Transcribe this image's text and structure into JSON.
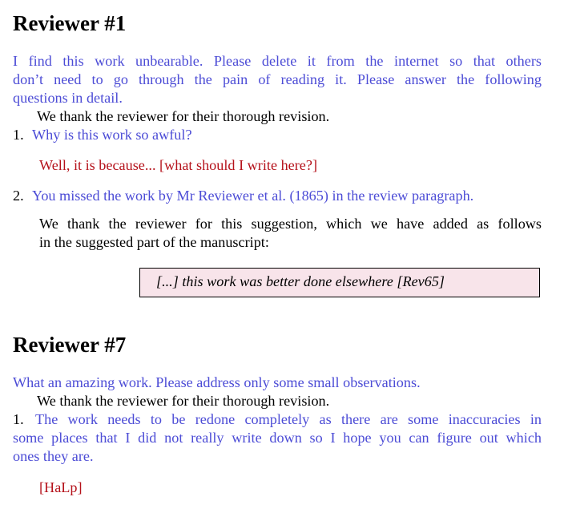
{
  "reviewer1": {
    "heading": "Reviewer #1",
    "intro_lines": [
      "I find this work unbearable.  Please delete it from the internet so that others",
      "don’t need to go through the pain of reading it.  Please answer the following",
      "questions in detail."
    ],
    "general_reply": "We thank the reviewer for their thorough revision.",
    "items": [
      {
        "number": "1.",
        "comment": "Why is this work so awful?",
        "reply_text": "Well, it is because... [what should I write here?]"
      },
      {
        "number": "2.",
        "comment": "You missed the work by Mr Reviewer et al. (1865) in the review paragraph.",
        "reply_lines": [
          "We thank the reviewer for this suggestion, which we have added as follows",
          "in the suggested part of the manuscript:"
        ],
        "quote": "[...] this work was better done elsewhere [Rev65]"
      }
    ]
  },
  "reviewer7": {
    "heading": "Reviewer #7",
    "intro": "What an amazing work. Please address only some small observations.",
    "general_reply": "We thank the reviewer for their thorough revision.",
    "items": [
      {
        "number": "1.",
        "comment_lines": [
          "The work needs to be redone completely as there are some inaccuracies in",
          "some places that I did not really write down so I hope you can figure out which",
          "ones they are."
        ],
        "reply_text": "[HaLp]"
      }
    ]
  },
  "colors": {
    "reviewer_comment": "#4c4cd6",
    "author_todo": "#b5121b",
    "quote_background": "#f8e4ea"
  }
}
